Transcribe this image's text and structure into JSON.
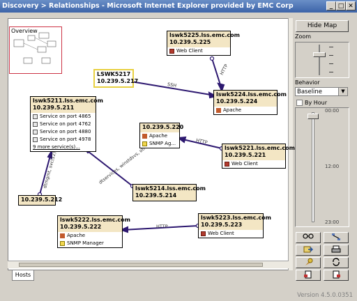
{
  "window": {
    "title": "Discovery > Relationships - Microsoft Internet Explorer provided by EMC Corp",
    "controls": [
      "minimize",
      "maximize",
      "close"
    ]
  },
  "map": {
    "overview_label": "Overview",
    "tab_label": "Hosts",
    "nodes": {
      "lswk5225": {
        "name": "lswk5225.lss.emc.com",
        "ip": "10.239.5.225",
        "rows": [
          {
            "icon": "web-client-icon",
            "text": "Web Client"
          }
        ]
      },
      "lswk5217": {
        "name": "LSWK5217",
        "ip": "10.239.5.217"
      },
      "lswk5224": {
        "name": "lswk5224.lss.emc.com",
        "ip": "10.239.5.224",
        "rows": [
          {
            "icon": "apache-icon",
            "text": "Apache"
          }
        ]
      },
      "lswk5211": {
        "name": "lswk5211.lss.emc.com",
        "ip": "10.239.5.211",
        "rows": [
          {
            "icon": "service-icon",
            "text": "Service on port 4865"
          },
          {
            "icon": "service-icon",
            "text": "Service on port 4762"
          },
          {
            "icon": "service-icon",
            "text": "Service on port 4880"
          },
          {
            "icon": "service-icon",
            "text": "Service on port 4978"
          }
        ],
        "more": "9 more service(s)..."
      },
      "node5220": {
        "ip": "10.239.5.220",
        "rows": [
          {
            "icon": "apache-icon",
            "text": "Apache"
          },
          {
            "icon": "snmp-icon",
            "text": "SNMP Ag..."
          }
        ]
      },
      "lswk5221": {
        "name": "lswk5221.lss.emc.com",
        "ip": "10.239.5.221",
        "rows": [
          {
            "icon": "web-client-icon",
            "text": "Web Client"
          }
        ]
      },
      "lswk5214": {
        "name": "lswk5214.lss.emc.com",
        "ip": "10.239.5.214"
      },
      "node5212": {
        "ip": "10.239.5.212"
      },
      "lswk5222": {
        "name": "lswk5222.lss.emc.com",
        "ip": "10.239.5.222",
        "rows": [
          {
            "icon": "apache-icon",
            "text": "Apache"
          },
          {
            "icon": "snmp-icon",
            "text": "SNMP Manager"
          }
        ]
      },
      "lswk5223": {
        "name": "lswk5223.lss.emc.com",
        "ip": "10.239.5.223",
        "rows": [
          {
            "icon": "web-client-icon",
            "text": "Web Client"
          }
        ]
      }
    },
    "edges": {
      "http_5225_5224": "HTTP",
      "ssh_5217_5224": "SSH",
      "http_5221_5220": "HTTP",
      "svc_5214_5211": "dtservices, winstdsvs, other(2)",
      "svc_5212_5211": "dtmgmt, svc(12)",
      "http_5223_5222": "HTTP"
    }
  },
  "panel": {
    "hide_map_label": "Hide Map",
    "zoom_label": "Zoom",
    "behavior_label": "Behavior",
    "behavior_value": "Baseline",
    "by_hour_label": "By Hour",
    "by_hour_checked": false,
    "time_ticks": [
      "00:00",
      "12:00",
      "23:00"
    ],
    "zoom_level": 0.35,
    "time_level": 0.05,
    "tool_buttons": [
      "glasses-icon",
      "layout-icon",
      "export-icon",
      "print-icon",
      "pin-icon",
      "refresh-icon",
      "report-a-icon",
      "report-b-icon"
    ]
  },
  "status": {
    "version": "Version 4.5.0.0351"
  }
}
